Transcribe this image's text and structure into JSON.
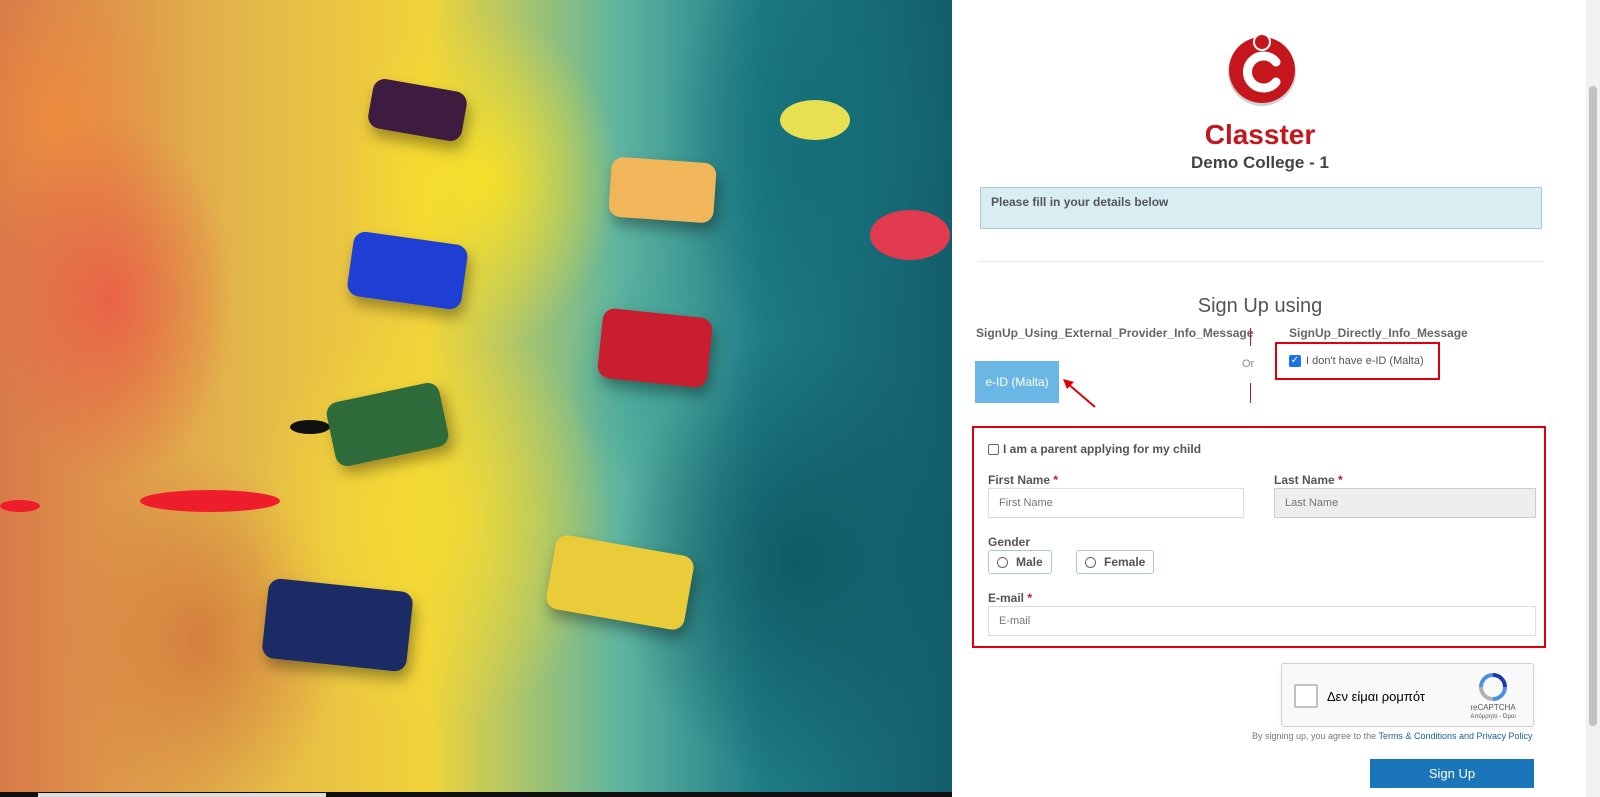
{
  "brand": {
    "name": "Classter",
    "college": "Demo College - 1"
  },
  "info_message": "Please fill in your details below",
  "signup_heading": "Sign Up using",
  "external_provider_msg": "SignUp_Using_External_Provider_Info_Message",
  "direct_msg": "SignUp_Directly_Info_Message",
  "or_label": "Or",
  "eid_button": "e-ID (Malta)",
  "no_eid_checkbox": {
    "label": "I don't have e-ID (Malta)",
    "checked": true
  },
  "form": {
    "parent_checkbox": "I am a parent applying for my child",
    "first_name": {
      "label": "First Name",
      "required": "*",
      "placeholder": "First Name"
    },
    "last_name": {
      "label": "Last Name",
      "required": "*",
      "placeholder": "Last Name"
    },
    "gender": {
      "label": "Gender",
      "options": [
        "Male",
        "Female"
      ]
    },
    "email": {
      "label": "E-mail",
      "required": "*",
      "placeholder": "E-mail"
    }
  },
  "captcha": {
    "text": "Δεν είμαι ρομπότ",
    "brand": "reCAPTCHA",
    "privacy": "Απόρρητο - Όροι"
  },
  "terms": {
    "prefix": "By signing up, you agree to the",
    "link": "Terms & Conditions and Privacy Policy"
  },
  "signup_button": "Sign Up",
  "colors": {
    "brand_red": "#c4161c",
    "primary_blue": "#1b75bb",
    "eid_blue": "#6ab7e6",
    "highlight_red": "#e0000d"
  }
}
